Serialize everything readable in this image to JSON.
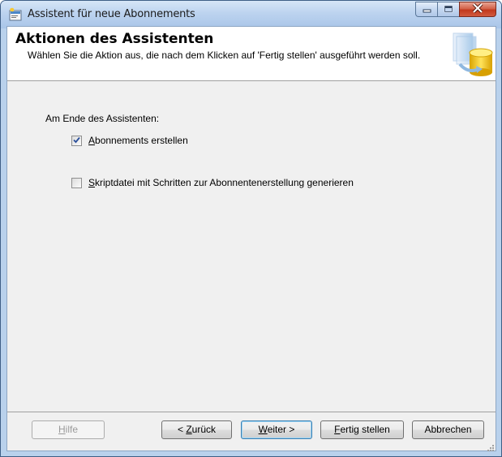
{
  "window": {
    "title": "Assistent für neue Abonnements"
  },
  "header": {
    "title": "Aktionen des Assistenten",
    "description": "Wählen Sie die Aktion aus, die nach dem Klicken auf 'Fertig stellen' ausgeführt werden soll."
  },
  "options": {
    "section_label": "Am Ende des Assistenten:",
    "items": [
      {
        "hotkey": "A",
        "rest": "bonnements erstellen",
        "checked": true
      },
      {
        "hotkey": "S",
        "rest": "kriptdatei mit Schritten zur Abonnentenerstellung generieren",
        "checked": false
      }
    ]
  },
  "buttons": {
    "help": {
      "hotkey": "H",
      "rest": "ilfe",
      "enabled": false
    },
    "back": {
      "prefix": "< ",
      "hotkey": "Z",
      "rest": "urück"
    },
    "next": {
      "hotkey": "W",
      "rest": "eiter >"
    },
    "finish": {
      "hotkey": "F",
      "rest": "ertig stellen"
    },
    "cancel": {
      "label": "Abbrechen"
    }
  },
  "colors": {
    "accent": "#3c7fb1",
    "close_button": "#c2391d"
  },
  "icons": {
    "title_icon": "wizard-app-icon",
    "header_graphic": "database-wizard-icon",
    "minimize": "minimize-icon",
    "maximize": "maximize-icon",
    "close": "close-icon",
    "checkmark": "checkmark-icon",
    "resize": "resize-grip-icon"
  }
}
